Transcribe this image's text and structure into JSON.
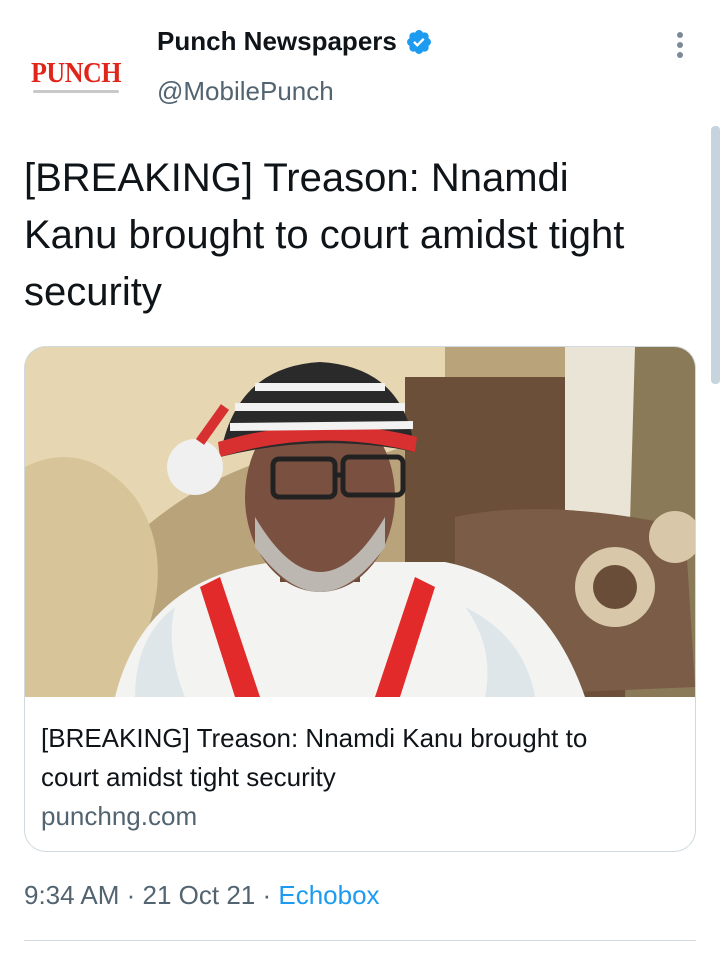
{
  "account": {
    "display_name": "Punch Newspapers",
    "handle": "@MobilePunch",
    "avatar_logo_text": "PUNCH",
    "verified_icon": "verified-badge-icon",
    "more_icon": "more-vertical-icon",
    "verified_color": "#1d9bf0"
  },
  "tweet": {
    "text": "[BREAKING] Treason: Nnamdi\nKanu brought to court amidst tight\nsecurity"
  },
  "card": {
    "image": "photo of man in red-white striped cap and glasses",
    "title": "[BREAKING] Treason: Nnamdi Kanu brought to\ncourt amidst tight security",
    "domain": "punchng.com"
  },
  "meta": {
    "time": "9:34 AM",
    "sep1": " · ",
    "date": "21 Oct 21",
    "sep2": " · ",
    "source": "Echobox"
  },
  "colors": {
    "text_primary": "#0f1419",
    "text_secondary": "#536471",
    "link": "#1d9bf0",
    "border": "#cfd9de",
    "logo_red": "#e0261b"
  }
}
